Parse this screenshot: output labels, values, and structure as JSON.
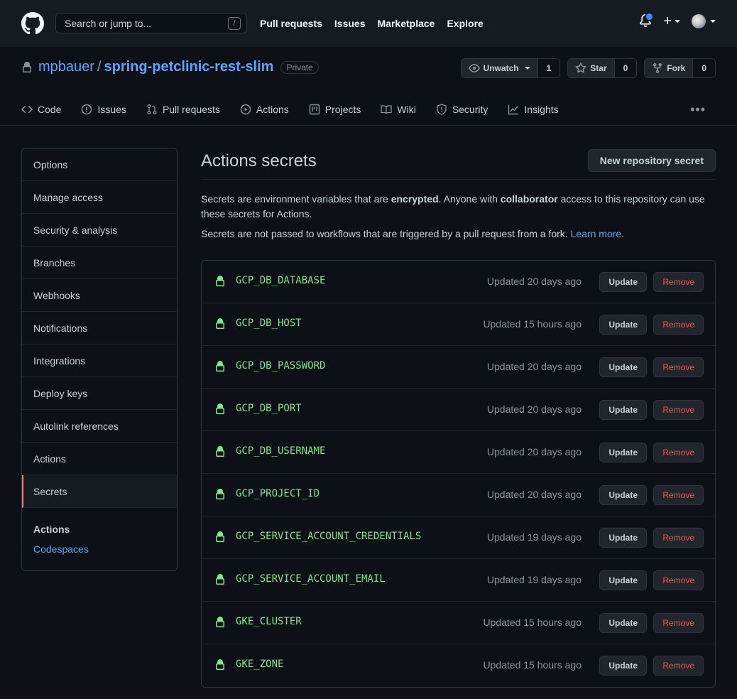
{
  "topbar": {
    "search_placeholder": "Search or jump to...",
    "search_shortcut": "/",
    "nav": [
      "Pull requests",
      "Issues",
      "Marketplace",
      "Explore"
    ],
    "plus_label": "+"
  },
  "repo": {
    "owner": "mpbauer",
    "separator": "/",
    "name": "spring-petclinic-rest-slim",
    "visibility": "Private",
    "unwatch_label": "Unwatch",
    "watch_count": "1",
    "star_label": "Star",
    "star_count": "0",
    "fork_label": "Fork",
    "fork_count": "0",
    "tabs": [
      "Code",
      "Issues",
      "Pull requests",
      "Actions",
      "Projects",
      "Wiki",
      "Security",
      "Insights"
    ],
    "more_label": "•••"
  },
  "sidebar": {
    "items": [
      "Options",
      "Manage access",
      "Security & analysis",
      "Branches",
      "Webhooks",
      "Notifications",
      "Integrations",
      "Deploy keys",
      "Autolink references",
      "Actions",
      "Secrets"
    ],
    "active_item": "Secrets",
    "group_heading": "Actions",
    "group_link": "Codespaces"
  },
  "main": {
    "title": "Actions secrets",
    "new_button": "New repository secret",
    "desc_part1": "Secrets are environment variables that are ",
    "desc_bold1": "encrypted",
    "desc_part2": ". Anyone with ",
    "desc_bold2": "collaborator",
    "desc_part3": " access to this repository can use these secrets for Actions.",
    "desc2_text": "Secrets are not passed to workflows that are triggered by a pull request from a fork. ",
    "desc2_link": "Learn more",
    "desc2_end": ".",
    "update_label": "Update",
    "remove_label": "Remove",
    "secrets": [
      {
        "name": "GCP_DB_DATABASE",
        "updated": "Updated 20 days ago"
      },
      {
        "name": "GCP_DB_HOST",
        "updated": "Updated 15 hours ago"
      },
      {
        "name": "GCP_DB_PASSWORD",
        "updated": "Updated 20 days ago"
      },
      {
        "name": "GCP_DB_PORT",
        "updated": "Updated 20 days ago"
      },
      {
        "name": "GCP_DB_USERNAME",
        "updated": "Updated 20 days ago"
      },
      {
        "name": "GCP_PROJECT_ID",
        "updated": "Updated 20 days ago"
      },
      {
        "name": "GCP_SERVICE_ACCOUNT_CREDENTIALS",
        "updated": "Updated 19 days ago"
      },
      {
        "name": "GCP_SERVICE_ACCOUNT_EMAIL",
        "updated": "Updated 19 days ago"
      },
      {
        "name": "GKE_CLUSTER",
        "updated": "Updated 15 hours ago"
      },
      {
        "name": "GKE_ZONE",
        "updated": "Updated 15 hours ago"
      }
    ]
  },
  "colors": {
    "background": "#0d1117",
    "header": "#161b22",
    "link": "#58a6ff",
    "secret_name": "#7ee787",
    "remove": "#f85149",
    "active_marker": "#f78166"
  },
  "icons": {
    "logo": "github-mark-icon",
    "bell": "bell-icon",
    "lock": "lock-icon",
    "eye": "eye-icon",
    "star": "star-icon",
    "fork": "repo-forked-icon"
  }
}
